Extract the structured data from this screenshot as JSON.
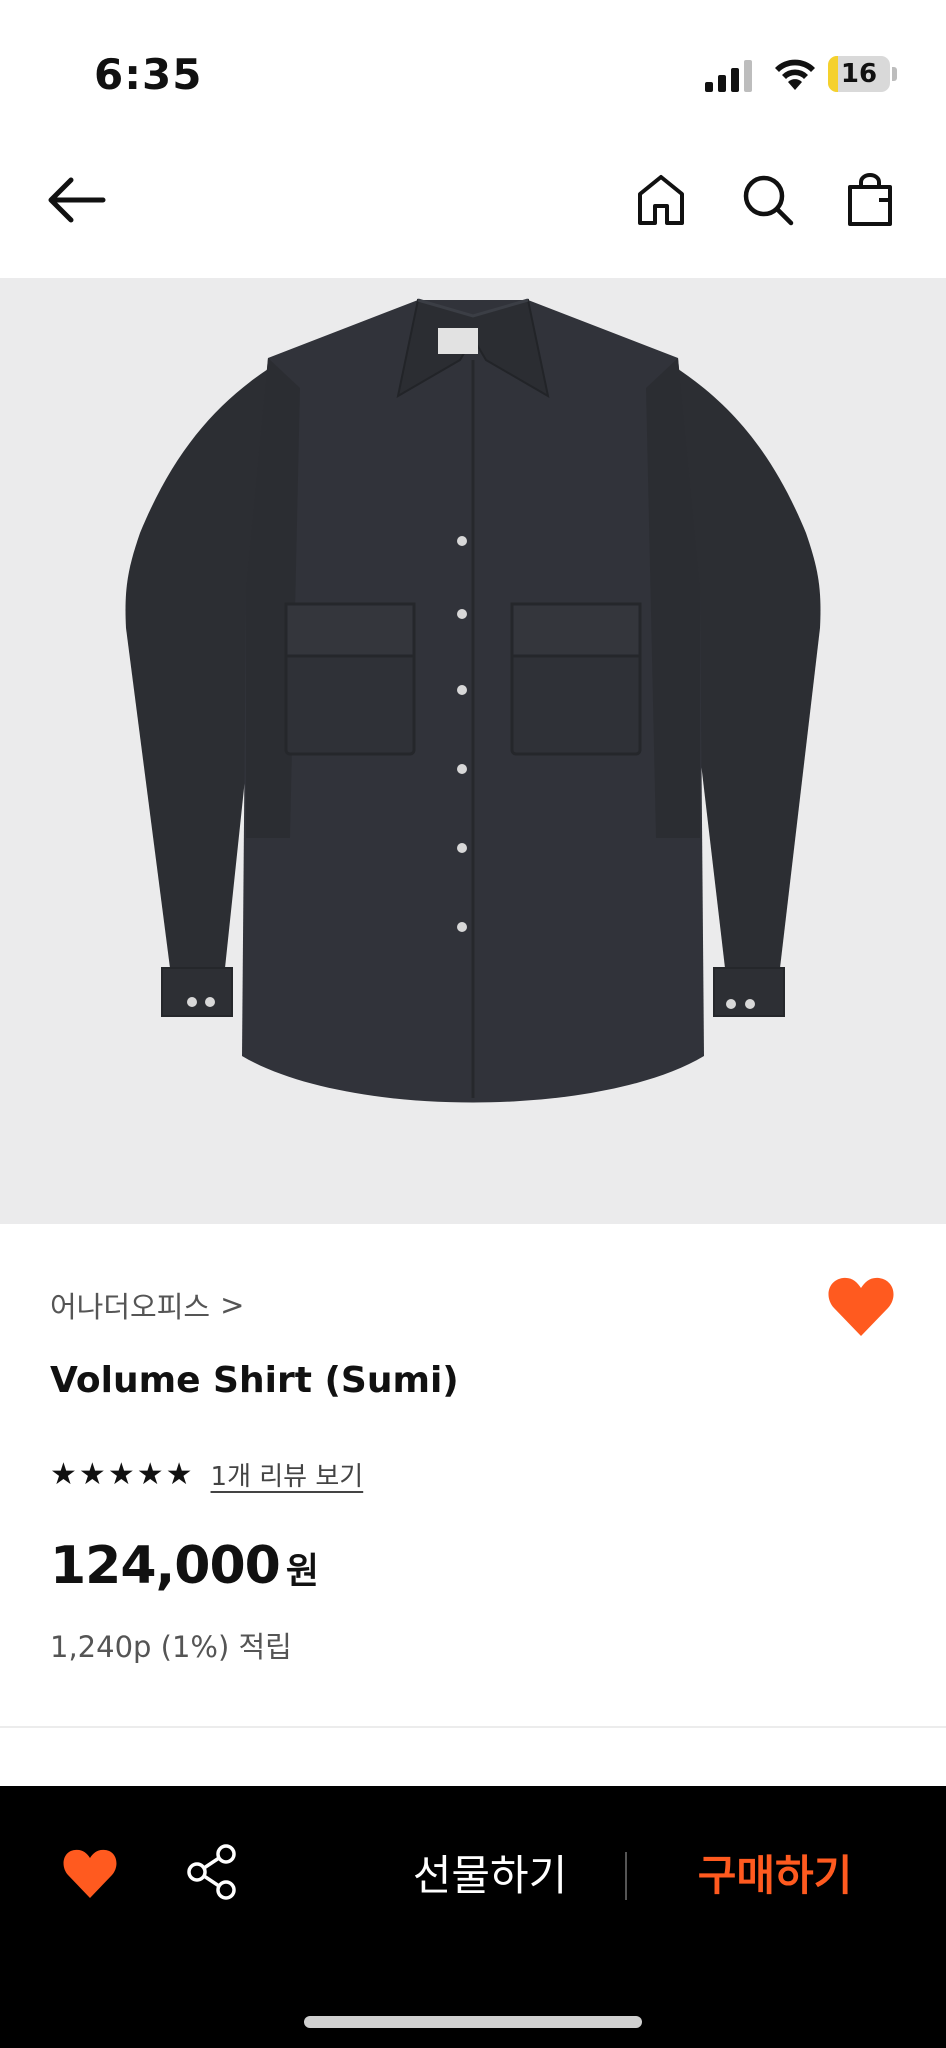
{
  "status_bar": {
    "time": "6:35",
    "battery": "16",
    "battery_level": 0.16
  },
  "nav": {
    "back_icon": "arrow-left-icon",
    "home_icon": "home-icon",
    "search_icon": "search-icon",
    "cart_icon": "shopping-bag-icon"
  },
  "product": {
    "brand": "어나더오피스",
    "brand_chevron": ">",
    "name": "Volume Shirt (Sumi)",
    "rating_stars": 5,
    "review_link": "1개 리뷰 보기",
    "price": "124,000",
    "currency": "원",
    "points": "1,240p (1%) 적립",
    "wishlisted": true
  },
  "bottom_bar": {
    "gift_label": "선물하기",
    "buy_label": "구매하기"
  },
  "colors": {
    "accent": "#ff5a1f",
    "image_bg": "#ebebec",
    "bar_bg": "#000000",
    "shirt": "#2f3136"
  }
}
